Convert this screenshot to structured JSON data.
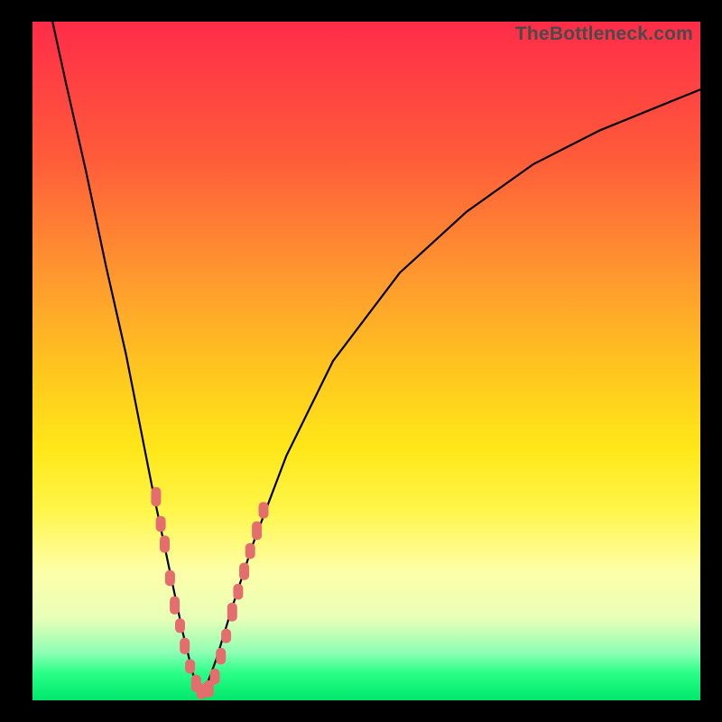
{
  "watermark": "TheBottleneck.com",
  "colors": {
    "gradient_top": "#ff2c49",
    "gradient_mid": "#ffe719",
    "gradient_bottom": "#00e76b",
    "curve": "#000000",
    "markers": "#e46e6e",
    "frame": "#000000"
  },
  "chart_data": {
    "type": "line",
    "title": "",
    "xlabel": "",
    "ylabel": "",
    "xlim": [
      0,
      100
    ],
    "ylim": [
      0,
      100
    ],
    "grid": false,
    "legend": false,
    "series": [
      {
        "name": "bottleneck-curve",
        "x": [
          3,
          5,
          8,
          11,
          14,
          16,
          18,
          19.5,
          21,
          22.5,
          24,
          25,
          26,
          27.5,
          30,
          33,
          38,
          45,
          55,
          65,
          75,
          85,
          95,
          100
        ],
        "y": [
          100,
          91,
          78,
          64,
          51,
          41,
          31,
          24,
          17,
          10,
          4,
          1,
          2,
          6,
          14,
          23,
          36,
          50,
          63,
          72,
          79,
          84,
          88,
          90
        ]
      }
    ],
    "markers": [
      {
        "x": 18.5,
        "y": 30,
        "size": 2.7
      },
      {
        "x": 19.2,
        "y": 26,
        "size": 2.2
      },
      {
        "x": 19.8,
        "y": 23,
        "size": 2.4
      },
      {
        "x": 20.6,
        "y": 18,
        "size": 2.2
      },
      {
        "x": 21.3,
        "y": 14,
        "size": 2.5
      },
      {
        "x": 22.1,
        "y": 11,
        "size": 2.0
      },
      {
        "x": 22.8,
        "y": 8,
        "size": 2.3
      },
      {
        "x": 23.6,
        "y": 5,
        "size": 2.0
      },
      {
        "x": 24.5,
        "y": 2.5,
        "size": 2.4
      },
      {
        "x": 25.3,
        "y": 1.3,
        "size": 2.2
      },
      {
        "x": 26.4,
        "y": 1.7,
        "size": 2.4
      },
      {
        "x": 27.3,
        "y": 3.5,
        "size": 2.2
      },
      {
        "x": 28.2,
        "y": 6.5,
        "size": 2.3
      },
      {
        "x": 29.0,
        "y": 9.5,
        "size": 2.0
      },
      {
        "x": 29.9,
        "y": 13,
        "size": 2.6
      },
      {
        "x": 30.8,
        "y": 16,
        "size": 2.2
      },
      {
        "x": 31.7,
        "y": 19,
        "size": 2.4
      },
      {
        "x": 32.6,
        "y": 22,
        "size": 2.2
      },
      {
        "x": 33.6,
        "y": 25,
        "size": 2.6
      },
      {
        "x": 34.6,
        "y": 28,
        "size": 2.3
      }
    ]
  }
}
